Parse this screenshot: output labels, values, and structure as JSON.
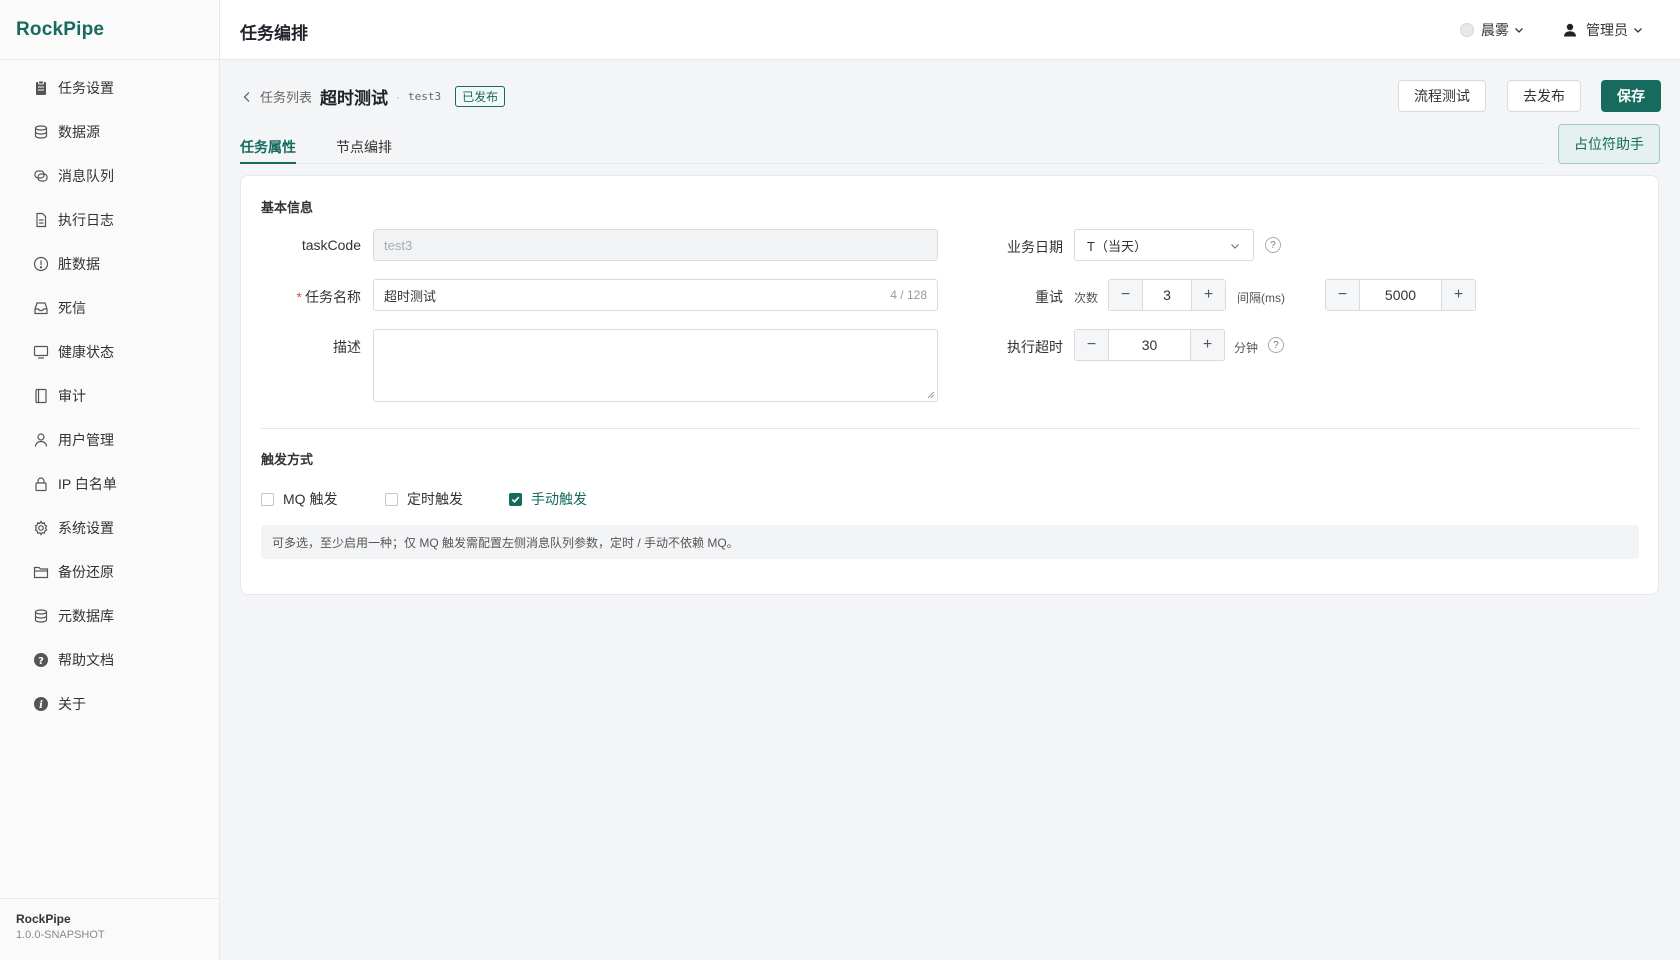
{
  "app": {
    "brand": "RockPipe",
    "version": "1.0.0-SNAPSHOT",
    "accent": "#166a5e"
  },
  "sidebar": {
    "items": [
      {
        "label": "任务设置",
        "icon": "clipboard-icon"
      },
      {
        "label": "数据源",
        "icon": "database-icon"
      },
      {
        "label": "消息队列",
        "icon": "message-queue-icon"
      },
      {
        "label": "执行日志",
        "icon": "document-icon"
      },
      {
        "label": "脏数据",
        "icon": "alert-circle-icon"
      },
      {
        "label": "死信",
        "icon": "inbox-icon"
      },
      {
        "label": "健康状态",
        "icon": "monitor-icon"
      },
      {
        "label": "审计",
        "icon": "book-icon"
      },
      {
        "label": "用户管理",
        "icon": "user-icon"
      },
      {
        "label": "IP 白名单",
        "icon": "lock-icon"
      },
      {
        "label": "系统设置",
        "icon": "gear-icon"
      },
      {
        "label": "备份还原",
        "icon": "folder-icon"
      },
      {
        "label": "元数据库",
        "icon": "database-icon"
      },
      {
        "label": "帮助文档",
        "icon": "question-circle-icon"
      },
      {
        "label": "关于",
        "icon": "info-circle-icon"
      }
    ]
  },
  "topbar": {
    "title": "任务编排",
    "theme": "晨雾",
    "user": "管理员"
  },
  "page": {
    "breadcrumb_link": "任务列表",
    "task_title": "超时测试",
    "separator": "·",
    "task_code": "test3",
    "status": "已发布"
  },
  "actions": {
    "test": "流程测试",
    "unpublish": "去发布",
    "save": "保存",
    "helper": "占位符助手"
  },
  "tabs": [
    {
      "label": "任务属性"
    },
    {
      "label": "节点编排"
    }
  ],
  "form": {
    "basic_title": "基本信息",
    "task_code_label": "taskCode",
    "task_code_value": "test3",
    "task_name_label": "任务名称",
    "required_mark": "*",
    "task_name_value": "超时测试",
    "task_name_counter": "4 / 128",
    "desc_label": "描述",
    "biz_date_label": "业务日期",
    "biz_date_value": "T（当天）",
    "help_mark": "?",
    "retry_label": "重试",
    "retry_count_label": "次数",
    "retry_count": "3",
    "retry_interval_label": "间隔(ms)",
    "retry_interval": "5000",
    "timeout_label": "执行超时",
    "timeout_value": "30",
    "timeout_unit": "分钟",
    "minus": "−",
    "plus": "+"
  },
  "trigger": {
    "title": "触发方式",
    "options": [
      {
        "label": "MQ 触发",
        "checked": false
      },
      {
        "label": "定时触发",
        "checked": false
      },
      {
        "label": "手动触发",
        "checked": true
      }
    ],
    "hint": "可多选，至少启用一种；仅 MQ 触发需配置左侧消息队列参数，定时 / 手动不依赖 MQ。"
  }
}
